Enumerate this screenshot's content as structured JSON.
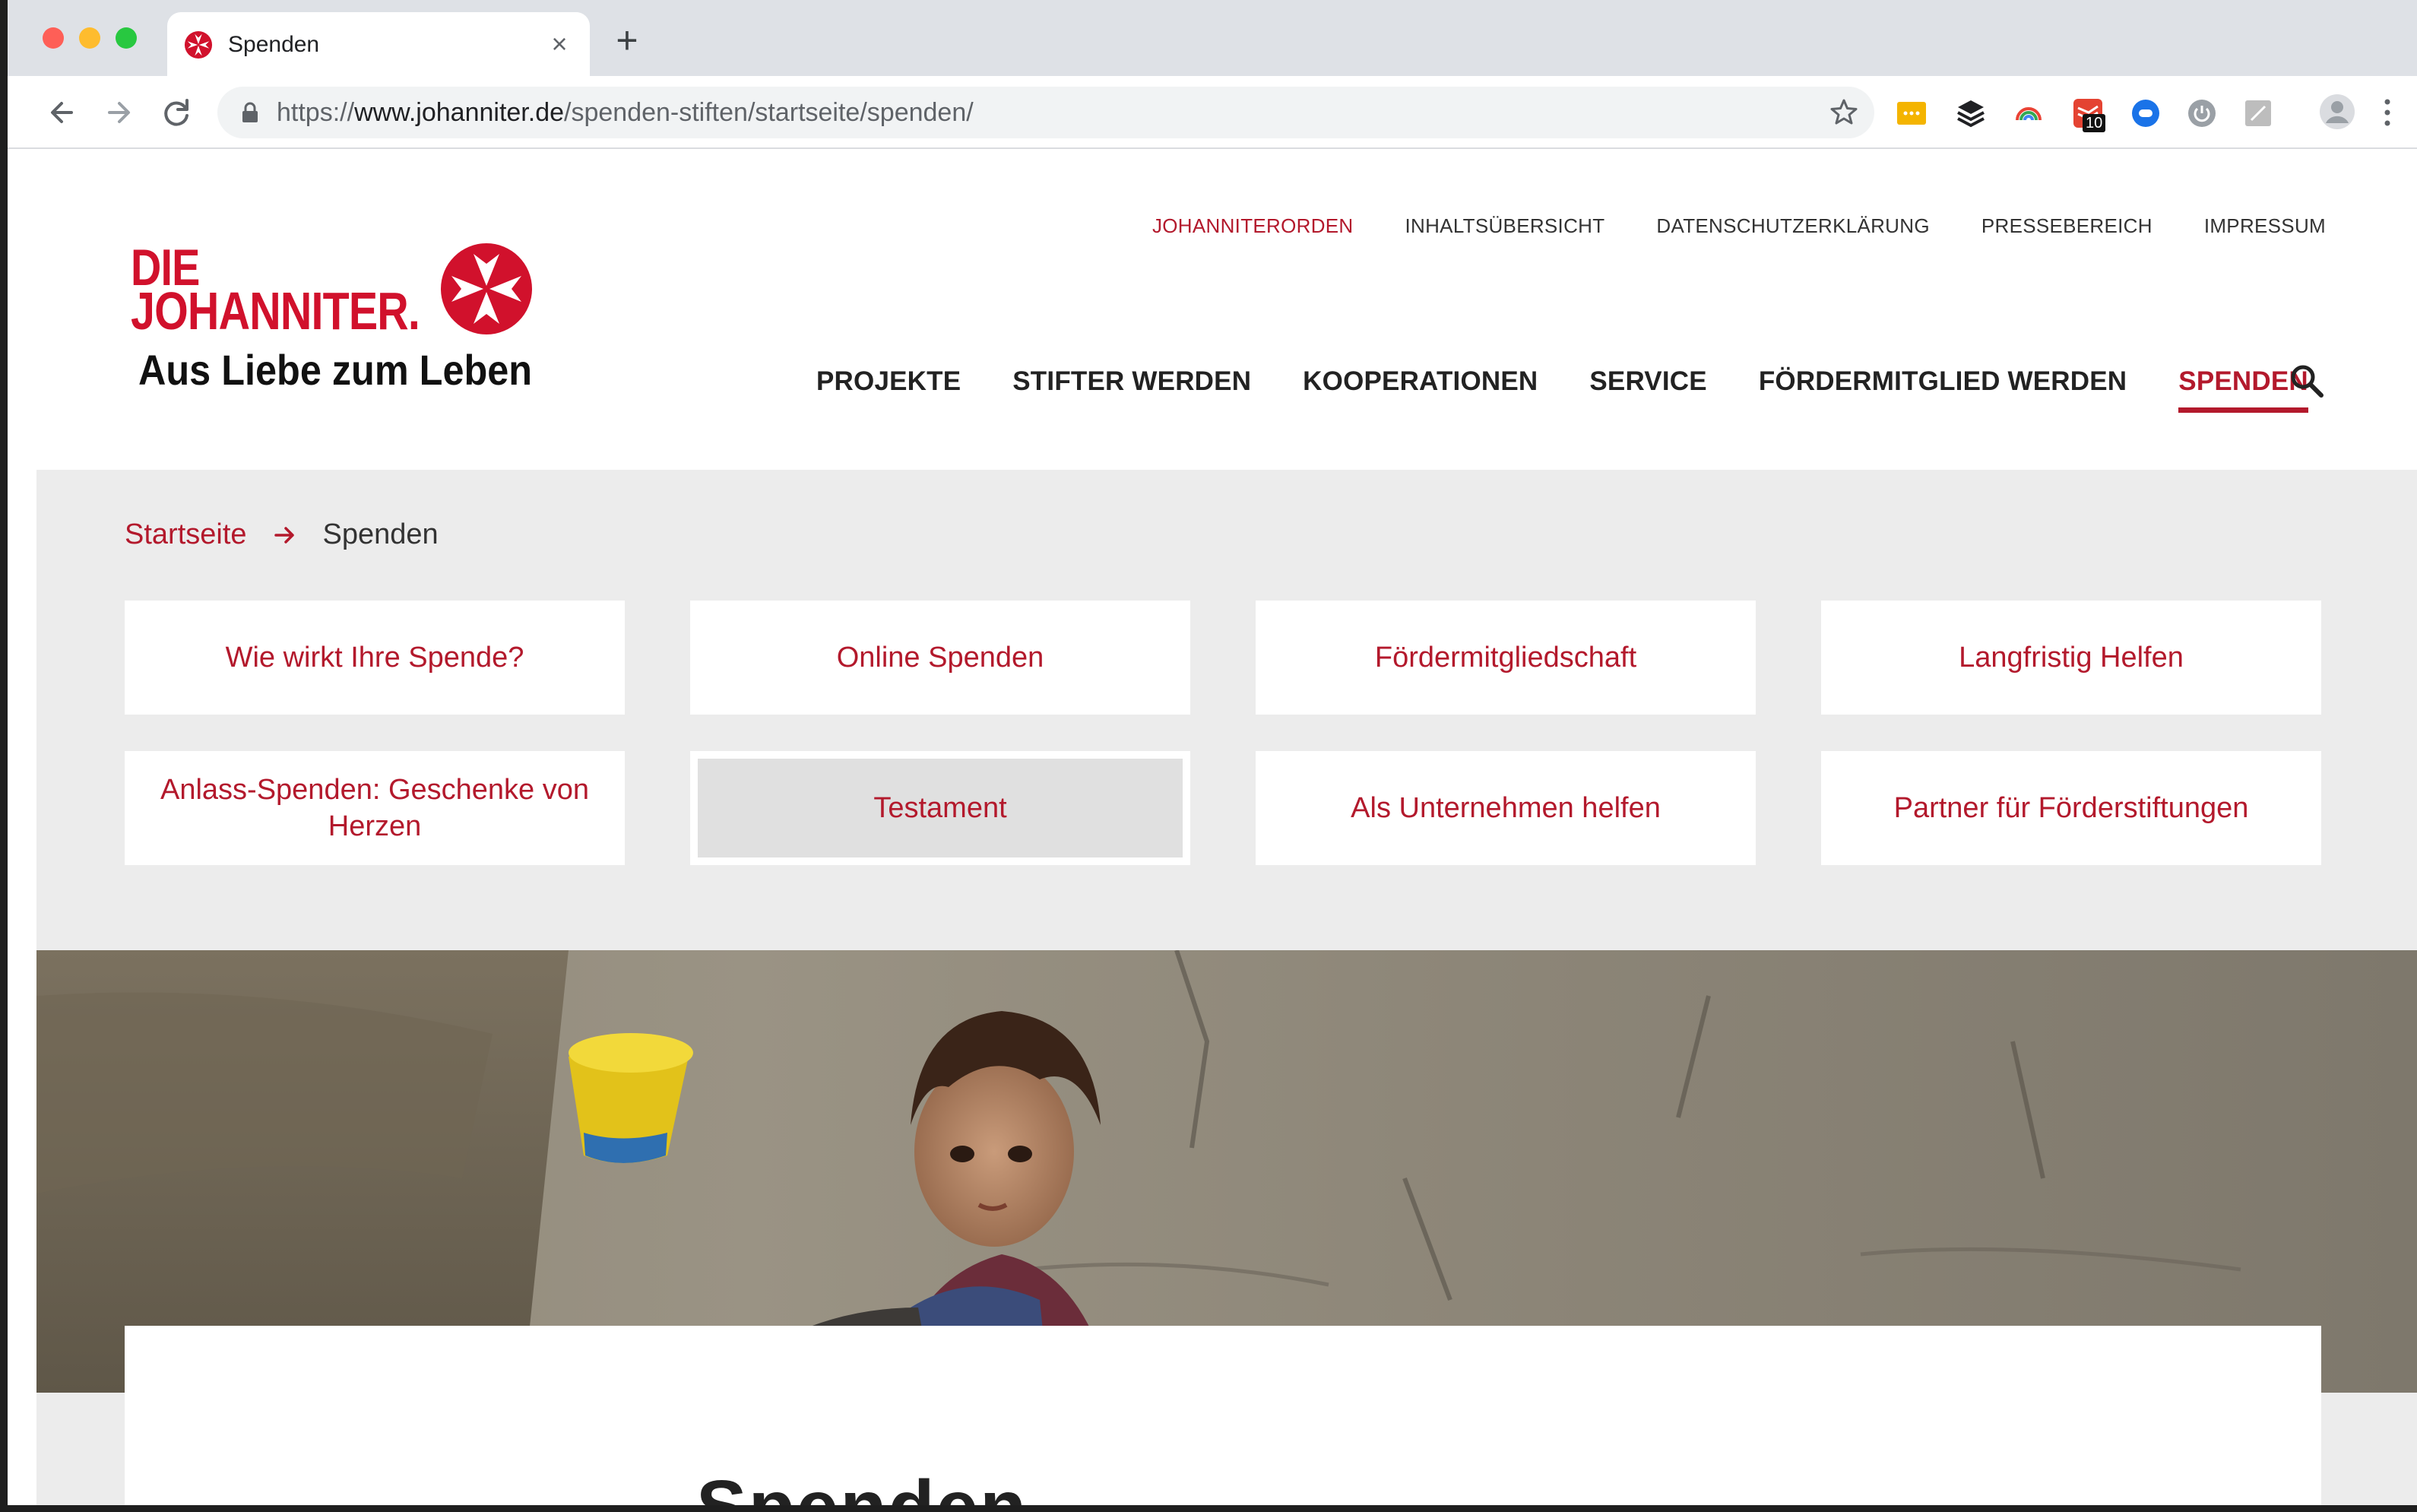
{
  "browser": {
    "tab_title": "Spenden",
    "tab_close": "×",
    "new_tab": "+",
    "url_scheme": "https://",
    "url_host": "www.johanniter.de",
    "url_path": "/spenden-stiften/startseite/spenden/",
    "extension_badge": "10"
  },
  "logo": {
    "line1": "DIE",
    "line2": "JOHANNITER.",
    "tagline": "Aus Liebe zum Leben",
    "brand_color": "#d1112c"
  },
  "meta_nav": [
    {
      "label": "JOHANNITERORDEN",
      "active": true
    },
    {
      "label": "INHALTSÜBERSICHT",
      "active": false
    },
    {
      "label": "DATENSCHUTZERKLÄRUNG",
      "active": false
    },
    {
      "label": "PRESSEBEREICH",
      "active": false
    },
    {
      "label": "IMPRESSUM",
      "active": false
    }
  ],
  "main_nav": [
    {
      "label": "PROJEKTE",
      "active": false
    },
    {
      "label": "STIFTER WERDEN",
      "active": false
    },
    {
      "label": "KOOPERATIONEN",
      "active": false
    },
    {
      "label": "SERVICE",
      "active": false
    },
    {
      "label": "FÖRDERMITGLIED WERDEN",
      "active": false
    },
    {
      "label": "SPENDEN",
      "active": true
    }
  ],
  "breadcrumb": {
    "home": "Startseite",
    "current": "Spenden"
  },
  "tiles": [
    {
      "label": "Wie wirkt Ihre Spende?"
    },
    {
      "label": "Online Spenden"
    },
    {
      "label": "Fördermitgliedschaft"
    },
    {
      "label": "Langfristig Helfen"
    },
    {
      "label": "Anlass-Spenden: Geschenke von Herzen"
    },
    {
      "label": "Testament",
      "selected": true
    },
    {
      "label": "Als Unternehmen helfen"
    },
    {
      "label": "Partner für Förderstiftungen"
    }
  ],
  "content": {
    "title": "Spenden"
  },
  "colors": {
    "accent": "#b3192c",
    "grey_bg": "#ececec"
  }
}
